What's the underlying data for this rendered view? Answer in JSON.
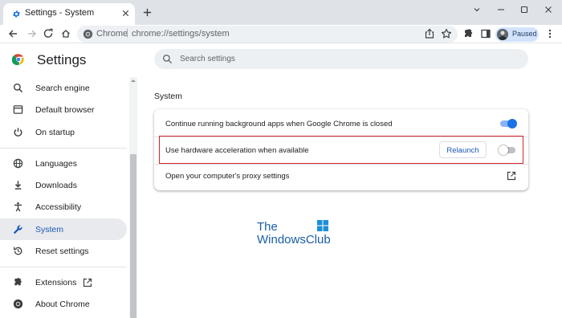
{
  "tab": {
    "title": "Settings - System"
  },
  "omnibox": {
    "site_label": "Chrome",
    "separator": "|",
    "url": "chrome://settings/system"
  },
  "profile": {
    "status": "Paused"
  },
  "header": {
    "title": "Settings",
    "search_placeholder": "Search settings"
  },
  "sidebar": {
    "items": [
      {
        "label": "Search engine",
        "icon": "search-icon"
      },
      {
        "label": "Default browser",
        "icon": "browser-icon"
      },
      {
        "label": "On startup",
        "icon": "power-icon"
      },
      {
        "label": "Languages",
        "icon": "globe-icon"
      },
      {
        "label": "Downloads",
        "icon": "download-icon"
      },
      {
        "label": "Accessibility",
        "icon": "accessibility-icon"
      },
      {
        "label": "System",
        "icon": "wrench-icon",
        "active": true
      },
      {
        "label": "Reset settings",
        "icon": "reset-icon"
      },
      {
        "label": "Extensions",
        "icon": "puzzle-icon"
      },
      {
        "label": "About Chrome",
        "icon": "chrome-logo-icon"
      }
    ]
  },
  "main": {
    "section_title": "System",
    "rows": [
      {
        "label": "Continue running background apps when Google Chrome is closed",
        "toggle_on": true
      },
      {
        "label": "Use hardware acceleration when available",
        "button": "Relaunch",
        "toggle_on": false
      },
      {
        "label": "Open your computer's proxy settings"
      }
    ]
  },
  "watermark": {
    "line1": "The",
    "line2": "WindowsClub"
  },
  "colors": {
    "accent": "#1a73e8",
    "highlight_border": "#d6242a",
    "active_nav_bg": "#e8eaed"
  }
}
